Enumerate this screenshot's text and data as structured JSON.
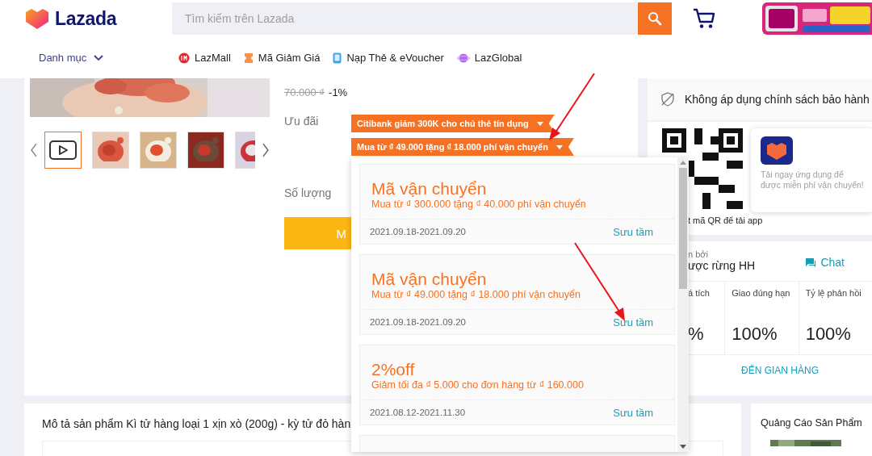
{
  "header": {
    "logo": "Lazada",
    "search": {
      "placeholder": "Tìm kiếm trên Lazada"
    },
    "category": "Danh mục",
    "links": [
      {
        "label": "LazMall",
        "kind": "lazmall"
      },
      {
        "label": "Mã Giảm Giá",
        "kind": "voucher"
      },
      {
        "label": "Nạp Thẻ & eVoucher",
        "kind": "topup"
      },
      {
        "label": "LazGlobal",
        "kind": "global"
      }
    ]
  },
  "product": {
    "original_price": "70.000 ₫",
    "discount": "-1%",
    "thumbnails": [
      {
        "kind": "video",
        "selected": true
      },
      {
        "kind": "picture",
        "selected": false
      },
      {
        "kind": "picture",
        "selected": false
      },
      {
        "kind": "picture",
        "selected": false
      },
      {
        "kind": "picture",
        "selected": false
      }
    ],
    "promo_label": "Ưu đãi",
    "promos": [
      "Citibank giảm 300K cho chủ thẻ tín dụng",
      "Mua từ ₫ 49.000 tặng ₫ 18.000 phí vận chuyển"
    ],
    "quantity_label": "Số lượng",
    "buy_button": "M"
  },
  "voucher_popup": {
    "vouchers": [
      {
        "title": "Mã vận chuyển",
        "description": "Mua từ ₫ 300.000 tặng ₫ 40.000 phí vận chuyển",
        "dates": "2021.09.18-2021.09.20",
        "action": "Sưu tầm"
      },
      {
        "title": "Mã vận chuyển",
        "description": "Mua từ ₫ 49.000 tặng ₫ 18.000 phí vận chuyển",
        "dates": "2021.09.18-2021.09.20",
        "action": "Sưu tầm"
      },
      {
        "title": "2%off",
        "description": "Giảm tối đa ₫ 5.000 cho đơn hàng từ ₫ 160.000",
        "dates": "2021.08.12-2021.11.30",
        "action": "Sưu tầm"
      }
    ]
  },
  "sidebar": {
    "warranty": "Không áp dụng chính sách bảo hành",
    "qr_caption": "t mã QR để tải app",
    "app_tip": "Tải ngay ứng dụng để được miễn phí vận chuyển!",
    "seller": {
      "sold_by": "n bởi",
      "name": "ược rừng HH",
      "chat": "Chat",
      "stats": [
        {
          "label": "á tích",
          "value": "%"
        },
        {
          "label": "Giao đúng hạn",
          "value": "100%"
        },
        {
          "label": "Tỷ lệ phản hồi",
          "value": "100%"
        }
      ],
      "store_link": "ĐẾN GIAN HÀNG"
    }
  },
  "description": {
    "title": "Mô tả sản phẩm Kì tử hàng loại 1 xịn xò (200g) - kỳ tử đỏ hàn"
  },
  "ads": {
    "title": "Quảng Cáo Sản Phẩm"
  }
}
